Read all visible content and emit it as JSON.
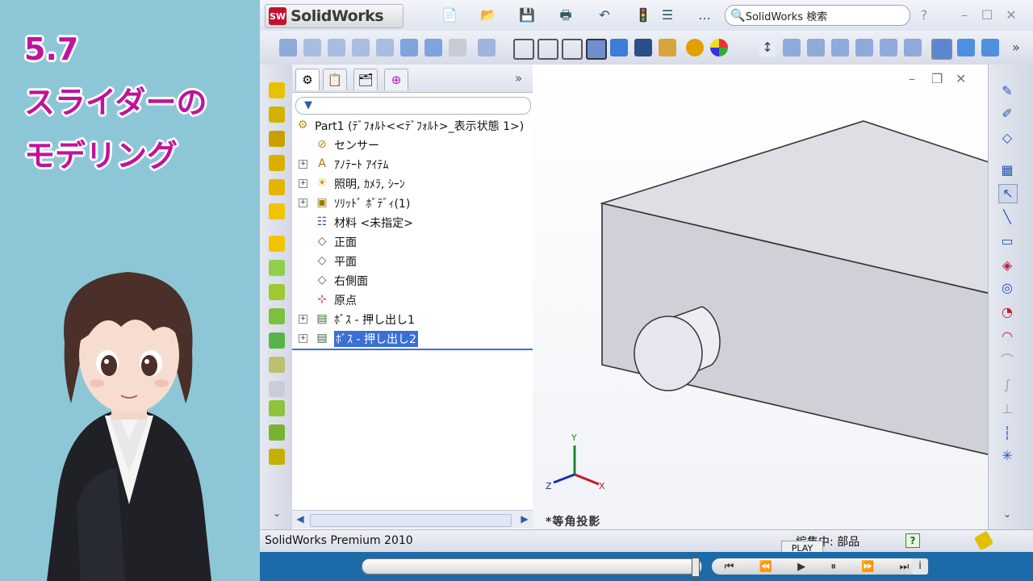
{
  "lesson": {
    "number": "5.7",
    "title_line1": "スライダーの",
    "title_line2": "モデリング"
  },
  "app": {
    "name": "SolidWorks",
    "logo_badge": "SW",
    "search_placeholder": "SolidWorks 検索",
    "toolbar_more": "...",
    "toolbar_overflow": "»"
  },
  "feature_manager": {
    "collapse": "»",
    "tree": [
      {
        "label": "Part1  (ﾃﾞﾌｫﾙﾄ<<ﾃﾞﾌｫﾙﾄ>_表示状態 1>)",
        "icon": "part-icon",
        "expander": false
      },
      {
        "label": "センサー",
        "icon": "sensor-icon",
        "expander": false
      },
      {
        "label": "ｱﾉﾃｰﾄ ｱｲﾃﾑ",
        "icon": "annotation-icon",
        "expander": true
      },
      {
        "label": "照明, ｶﾒﾗ, ｼｰﾝ",
        "icon": "lights-icon",
        "expander": true
      },
      {
        "label": "ｿﾘｯﾄﾞ ﾎﾞﾃﾞｨ(1)",
        "icon": "solid-body-icon",
        "expander": true
      },
      {
        "label": "材料 <未指定>",
        "icon": "material-icon",
        "expander": false
      },
      {
        "label": "正面",
        "icon": "plane-icon",
        "expander": false
      },
      {
        "label": "平面",
        "icon": "plane-icon",
        "expander": false
      },
      {
        "label": "右側面",
        "icon": "plane-icon",
        "expander": false
      },
      {
        "label": "原点",
        "icon": "origin-icon",
        "expander": false
      },
      {
        "label": "ﾎﾞｽ - 押し出し1",
        "icon": "extrude-icon",
        "expander": true
      },
      {
        "label": "ﾎﾞｽ - 押し出し2",
        "icon": "extrude-icon",
        "expander": true,
        "selected": true
      }
    ]
  },
  "viewport": {
    "view_name": "*等角投影",
    "triad": {
      "x": "X",
      "y": "Y",
      "z": "Z"
    }
  },
  "status": {
    "product": "SolidWorks Premium 2010",
    "mode": "編集中: 部品",
    "help": "?"
  },
  "player": {
    "play_label": "PLAY",
    "progress": 0.98,
    "info": "i"
  },
  "colors": {
    "title_text": "#c0139a",
    "selection": "#3b6fd6",
    "player_bar": "#1d6aa8"
  }
}
